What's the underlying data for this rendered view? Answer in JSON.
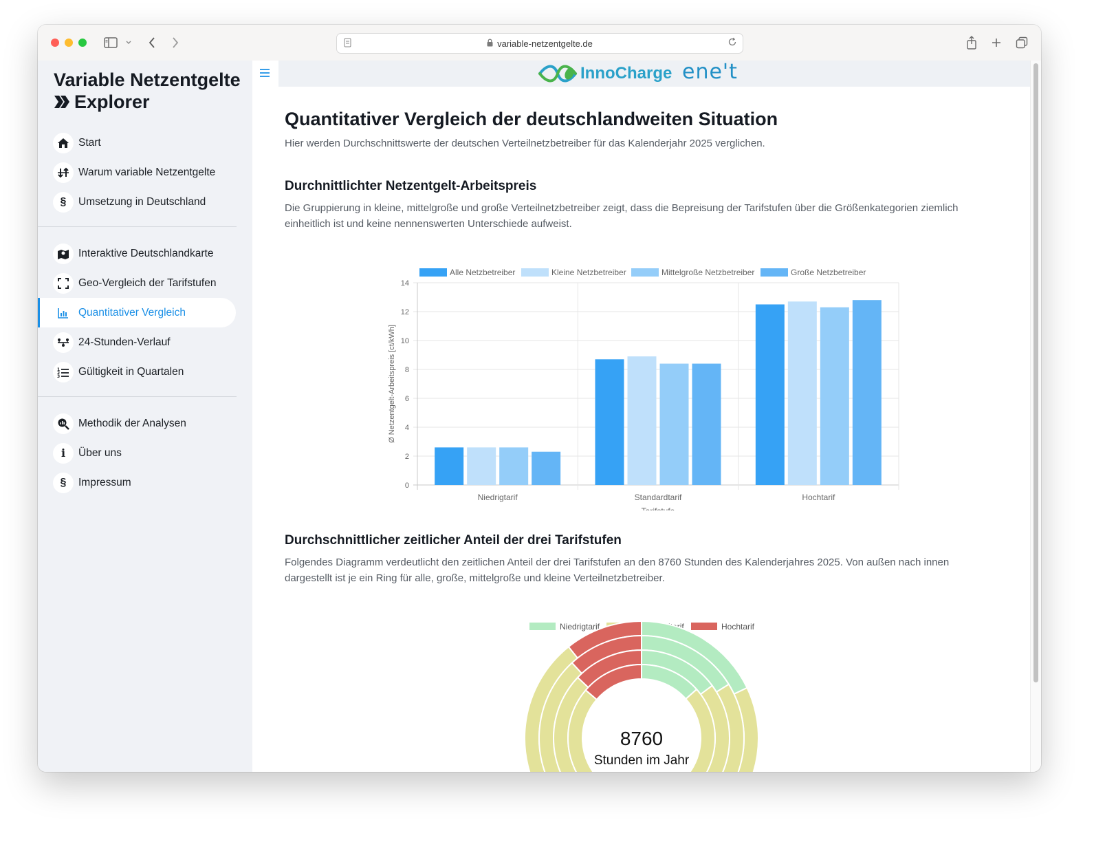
{
  "browser": {
    "url": "variable-netzentgelte.de",
    "icons": [
      "sidebar-toggle-icon",
      "chevron-down-icon",
      "back-icon",
      "forward-icon",
      "page-icon",
      "lock-icon",
      "reload-icon",
      "share-icon",
      "new-tab-icon",
      "tabs-overview-icon"
    ]
  },
  "sidebar": {
    "brand_line1": "Variable Netzentgelte",
    "brand_line2": "Explorer",
    "groups": [
      [
        {
          "label": "Start",
          "icon": "home-icon"
        },
        {
          "label": "Warum variable Netzentgelte",
          "icon": "arrows-icon"
        },
        {
          "label": "Umsetzung in Deutschland",
          "icon": "paragraph-icon"
        }
      ],
      [
        {
          "label": "Interaktive Deutschlandkarte",
          "icon": "map-icon"
        },
        {
          "label": "Geo-Vergleich der Tarifstufen",
          "icon": "expand-icon"
        },
        {
          "label": "Quantitativer Vergleich",
          "icon": "bar-chart-icon",
          "active": true
        },
        {
          "label": "24-Stunden-Verlauf",
          "icon": "timeline-icon"
        },
        {
          "label": "Gültigkeit in Quartalen",
          "icon": "list-icon"
        }
      ],
      [
        {
          "label": "Methodik der Analysen",
          "icon": "search-chart-icon"
        },
        {
          "label": "Über uns",
          "icon": "info-icon"
        },
        {
          "label": "Impressum",
          "icon": "paragraph-icon"
        }
      ]
    ],
    "active_color": "#1a8fe6"
  },
  "header": {
    "logo_inno": "InnoCharge",
    "logo_enet": "ene't"
  },
  "main": {
    "title": "Quantitativer Vergleich der deutschlandweiten Situation",
    "lead": "Hier werden Durchschnittswerte der deutschen Verteilnetzbetreiber für das Kalenderjahr 2025 verglichen.",
    "section1_title": "Durchnittlichter Netzentgelt-Arbeitspreis",
    "section1_text": "Die Gruppierung in kleine, mittelgroße und große Verteilnetzbetreiber zeigt, dass die Bepreisung der Tarifstufen über die Größenkategorien ziemlich einheitlich ist und keine nennenswerten Unterschiede aufweist.",
    "section2_title": "Durchschnittlicher zeitlicher Anteil der drei Tarifstufen",
    "section2_text": "Folgendes Diagramm verdeutlicht den zeitlichen Anteil der drei Tarifstufen an den 8760 Stunden des Kalenderjahres 2025. Von außen nach innen dargestellt ist je ein Ring für alle, große, mittelgroße und kleine Verteilnetzbetreiber."
  },
  "chart_data": [
    {
      "type": "bar",
      "categories": [
        "Niedrigtarif",
        "Standardtarif",
        "Hochtarif"
      ],
      "series": [
        {
          "name": "Alle Netzbetreiber",
          "color": "#36a2f5",
          "values": [
            2.6,
            8.7,
            12.5
          ]
        },
        {
          "name": "Kleine Netzbetreiber",
          "color": "#bfe0fb",
          "values": [
            2.6,
            8.9,
            12.7
          ]
        },
        {
          "name": "Mittelgroße Netzbetreiber",
          "color": "#94cdf9",
          "values": [
            2.6,
            8.4,
            12.3
          ]
        },
        {
          "name": "Große Netzbetreiber",
          "color": "#64b5f6",
          "values": [
            2.3,
            8.4,
            12.8
          ]
        }
      ],
      "xlabel": "Tarifstufe",
      "ylabel": "Ø Netzentgelt-Arbeitspreis [ct/kWh]",
      "ylim": [
        0,
        14
      ],
      "yticks": [
        0,
        2,
        4,
        6,
        8,
        10,
        12,
        14
      ],
      "grid": true,
      "legend": "top"
    },
    {
      "type": "pie",
      "subtype": "nested-doughnut",
      "center_value": "8760",
      "center_label": "Stunden im Jahr",
      "legend": "top",
      "labels": [
        "Niedrigtarif",
        "Standardtarif",
        "Hochtarif"
      ],
      "colors": [
        "#b3ebc1",
        "#e3e29a",
        "#d9655e"
      ],
      "rings": [
        {
          "values": [
            1570,
            6250,
            940
          ]
        },
        {
          "values": [
            1420,
            6300,
            1040
          ]
        },
        {
          "values": [
            1300,
            6330,
            1130
          ]
        },
        {
          "values": [
            1180,
            6380,
            1200
          ]
        }
      ]
    }
  ]
}
